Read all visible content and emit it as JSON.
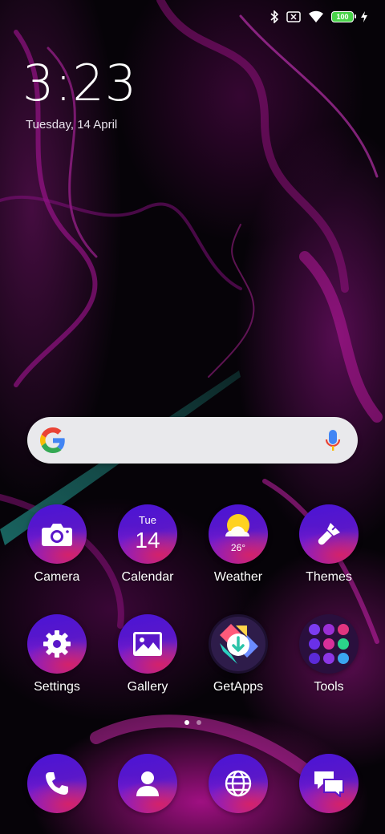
{
  "status_bar": {
    "icons": [
      "bluetooth-icon",
      "no-sim-icon",
      "wifi-icon",
      "battery-icon",
      "charging-icon"
    ],
    "battery_level": "100"
  },
  "clock": {
    "time": "3:23",
    "date": "Tuesday, 14 April"
  },
  "search": {
    "icons": [
      "google-g-icon",
      "microphone-icon"
    ]
  },
  "apps": [
    {
      "label": "Camera"
    },
    {
      "label": "Calendar",
      "weekday": "Tue",
      "day": "14"
    },
    {
      "label": "Weather",
      "temperature": "26°"
    },
    {
      "label": "Themes"
    },
    {
      "label": "Settings"
    },
    {
      "label": "Gallery"
    },
    {
      "label": "GetApps"
    },
    {
      "label": "Tools"
    }
  ],
  "dock": [
    {
      "icon": "phone-icon"
    },
    {
      "icon": "contacts-icon"
    },
    {
      "icon": "browser-globe-icon"
    },
    {
      "icon": "messages-icon"
    }
  ],
  "page_indicator": {
    "pages": 2,
    "active": 1
  },
  "colors": {
    "icon_gradient_top": "#4a14d6",
    "icon_gradient_bottom": "#d22a73",
    "wallpaper_accent": "#c21aa8",
    "battery_fill": "#49d34a"
  }
}
